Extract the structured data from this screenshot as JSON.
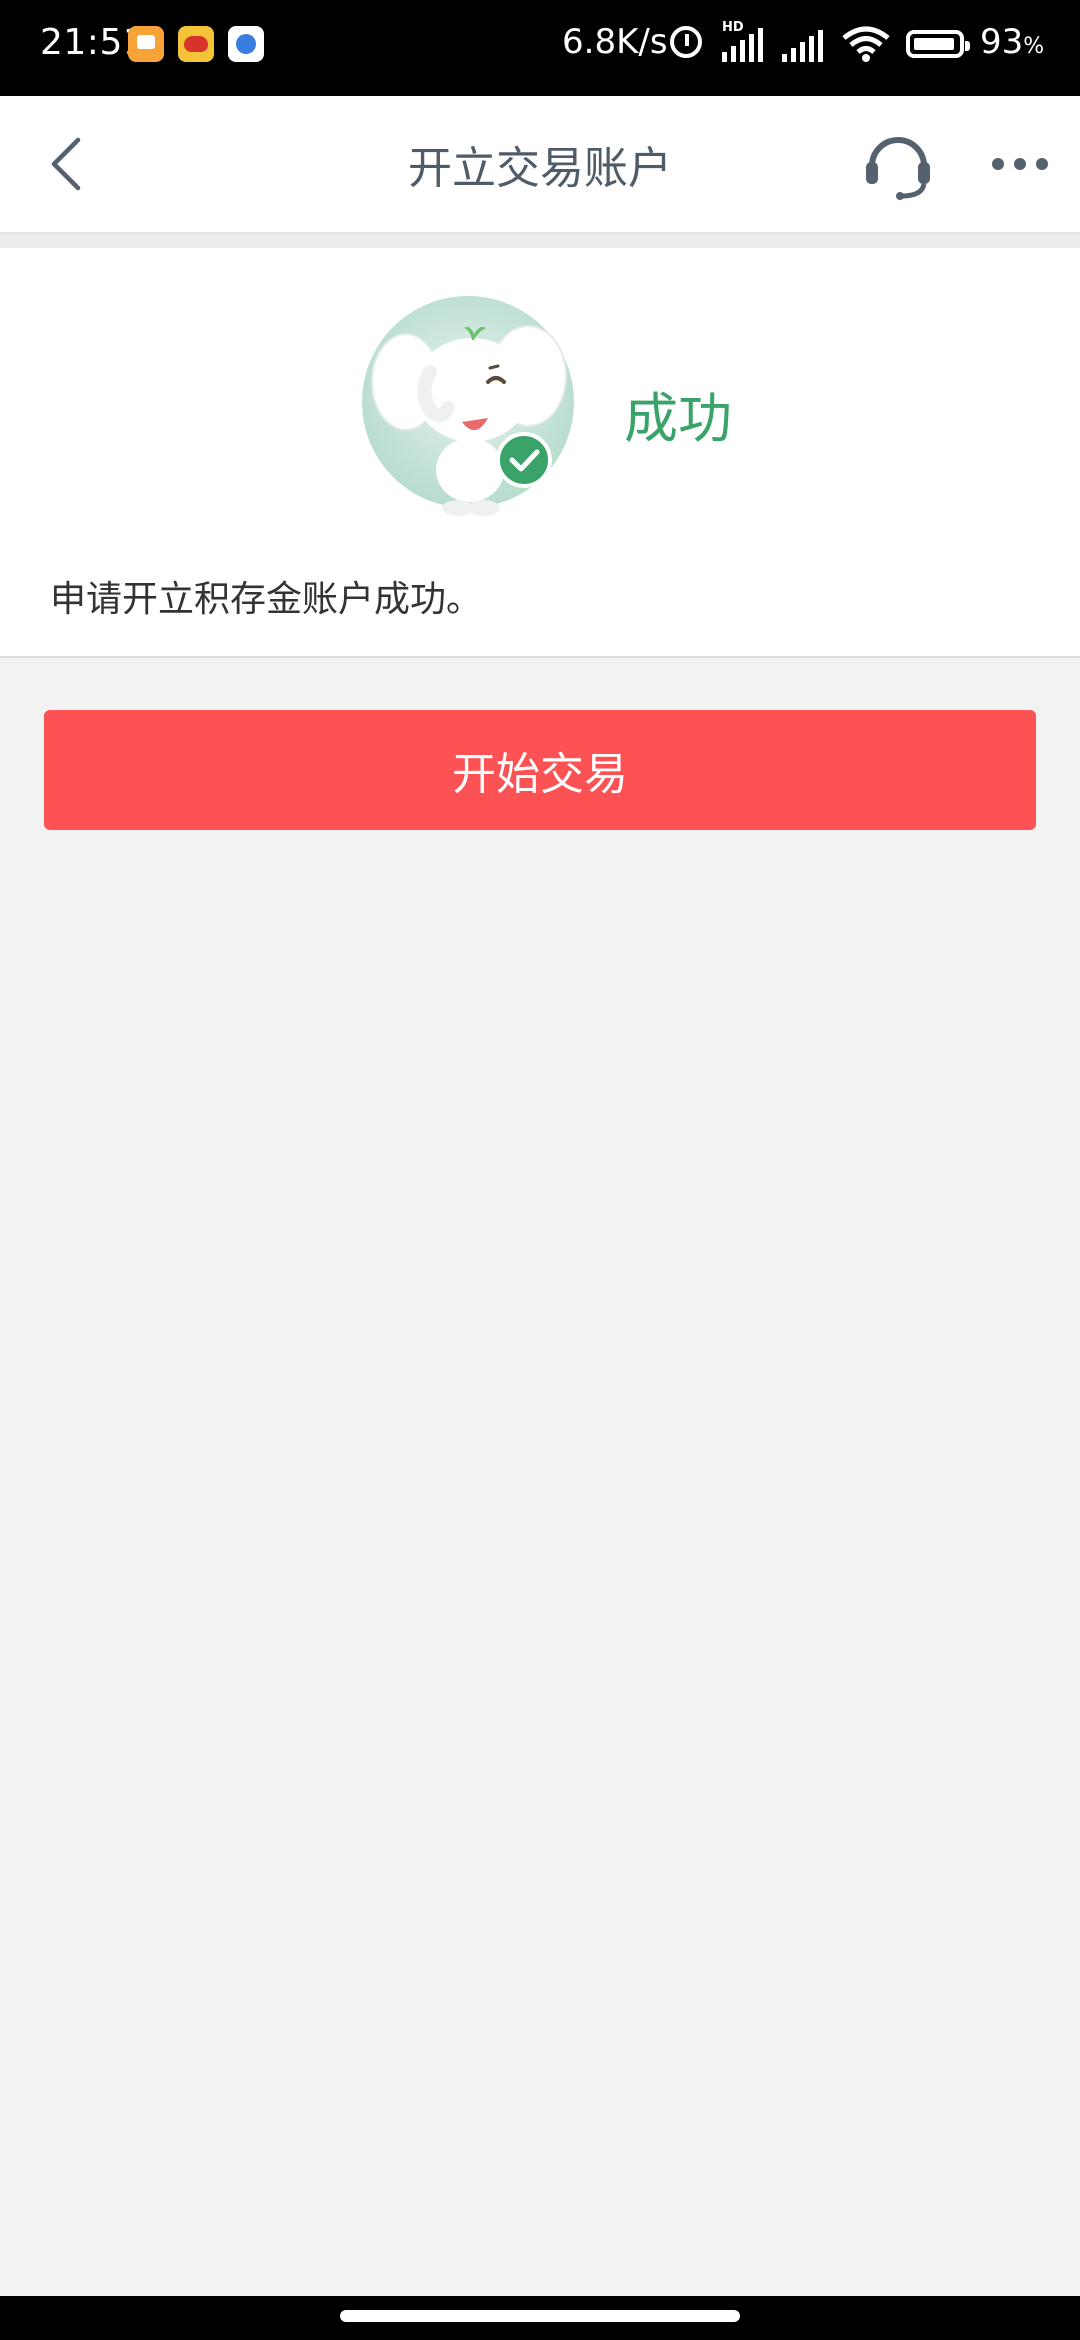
{
  "status_bar": {
    "time": "21:51",
    "network_speed": "6.8K/s",
    "hd_badge": "HD",
    "battery_percent": "93",
    "battery_unit": "%"
  },
  "header": {
    "title": "开立交易账户",
    "back_icon": "chevron-left-icon",
    "service_icon": "headset-icon",
    "more_icon": "more-dots-icon"
  },
  "result": {
    "status_label": "成功",
    "message": "申请开立积存金账户成功。",
    "status_color": "#3aa36a"
  },
  "actions": {
    "start_trading_label": "开始交易",
    "button_color": "#fd5254"
  }
}
